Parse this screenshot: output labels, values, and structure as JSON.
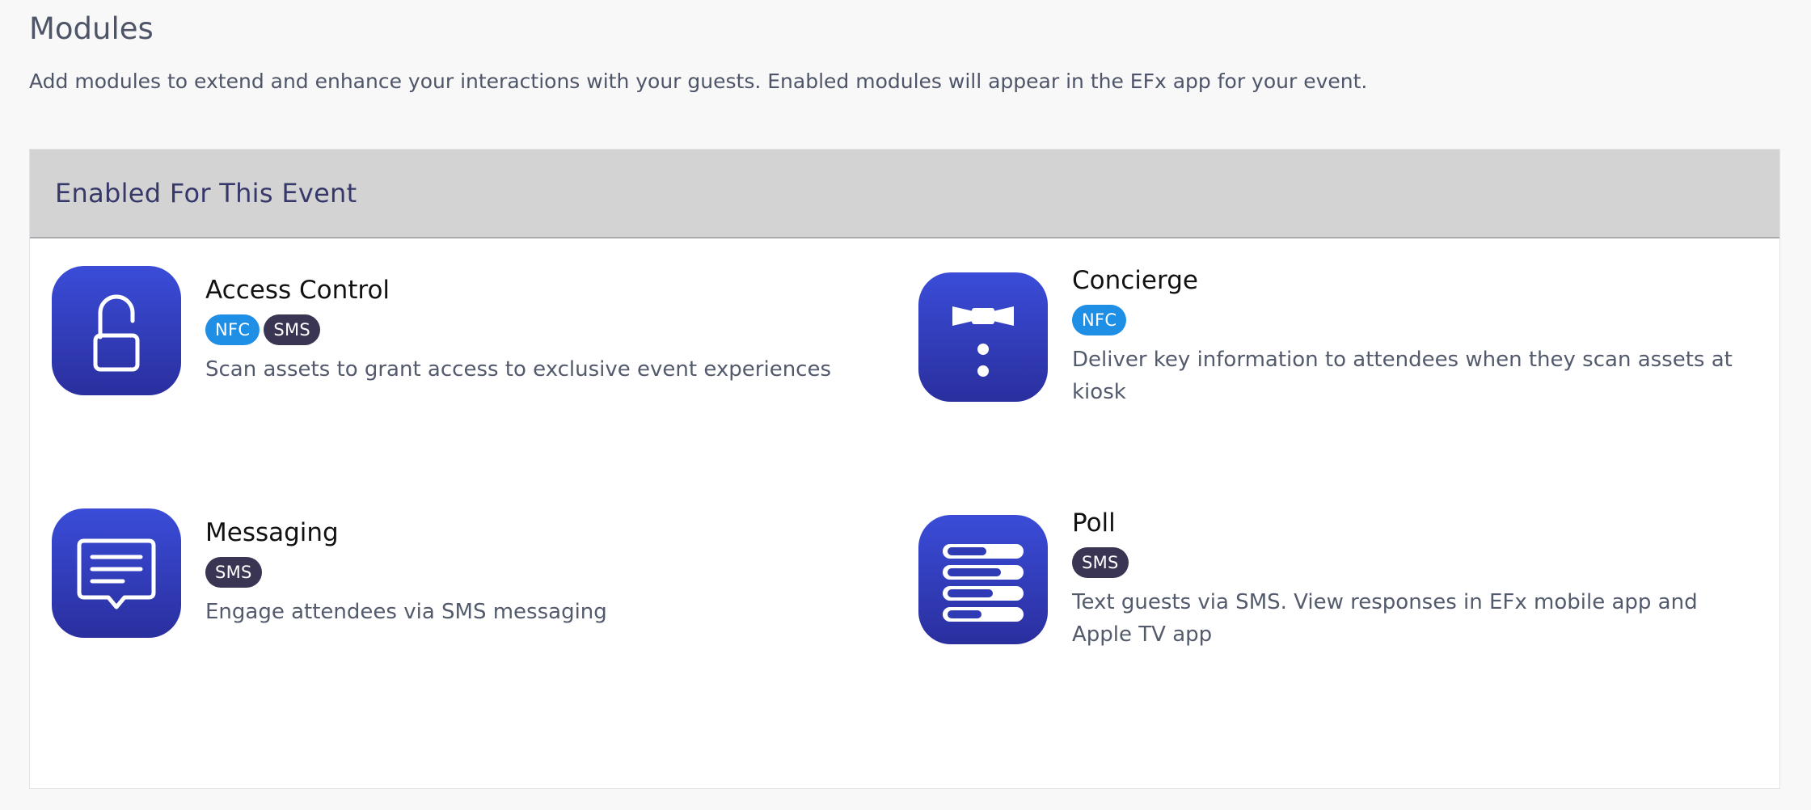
{
  "page": {
    "title": "Modules",
    "description": "Add modules to extend and enhance your interactions with your guests. Enabled modules will appear in the EFx app for your event."
  },
  "panel": {
    "title": "Enabled For This Event"
  },
  "modules": [
    {
      "name": "Access Control",
      "icon": "lock-icon",
      "badges": [
        "NFC",
        "SMS"
      ],
      "description": "Scan assets to grant access to exclusive event experiences"
    },
    {
      "name": "Concierge",
      "icon": "bowtie-icon",
      "badges": [
        "NFC"
      ],
      "description": "Deliver key information to attendees when they scan assets at kiosk"
    },
    {
      "name": "Messaging",
      "icon": "message-icon",
      "badges": [
        "SMS"
      ],
      "description": "Engage attendees via SMS messaging"
    },
    {
      "name": "Poll",
      "icon": "poll-icon",
      "badges": [
        "SMS"
      ],
      "description": "Text guests via SMS. View responses in EFx mobile app and Apple TV app"
    }
  ],
  "colors": {
    "icon_gradient_top": "#3a4cd8",
    "icon_gradient_bottom": "#2a2f9e",
    "badge_nfc": "#1f8fe6",
    "badge_sms": "#3a3553",
    "panel_header_bg": "#d3d3d4",
    "panel_title": "#37386a"
  }
}
